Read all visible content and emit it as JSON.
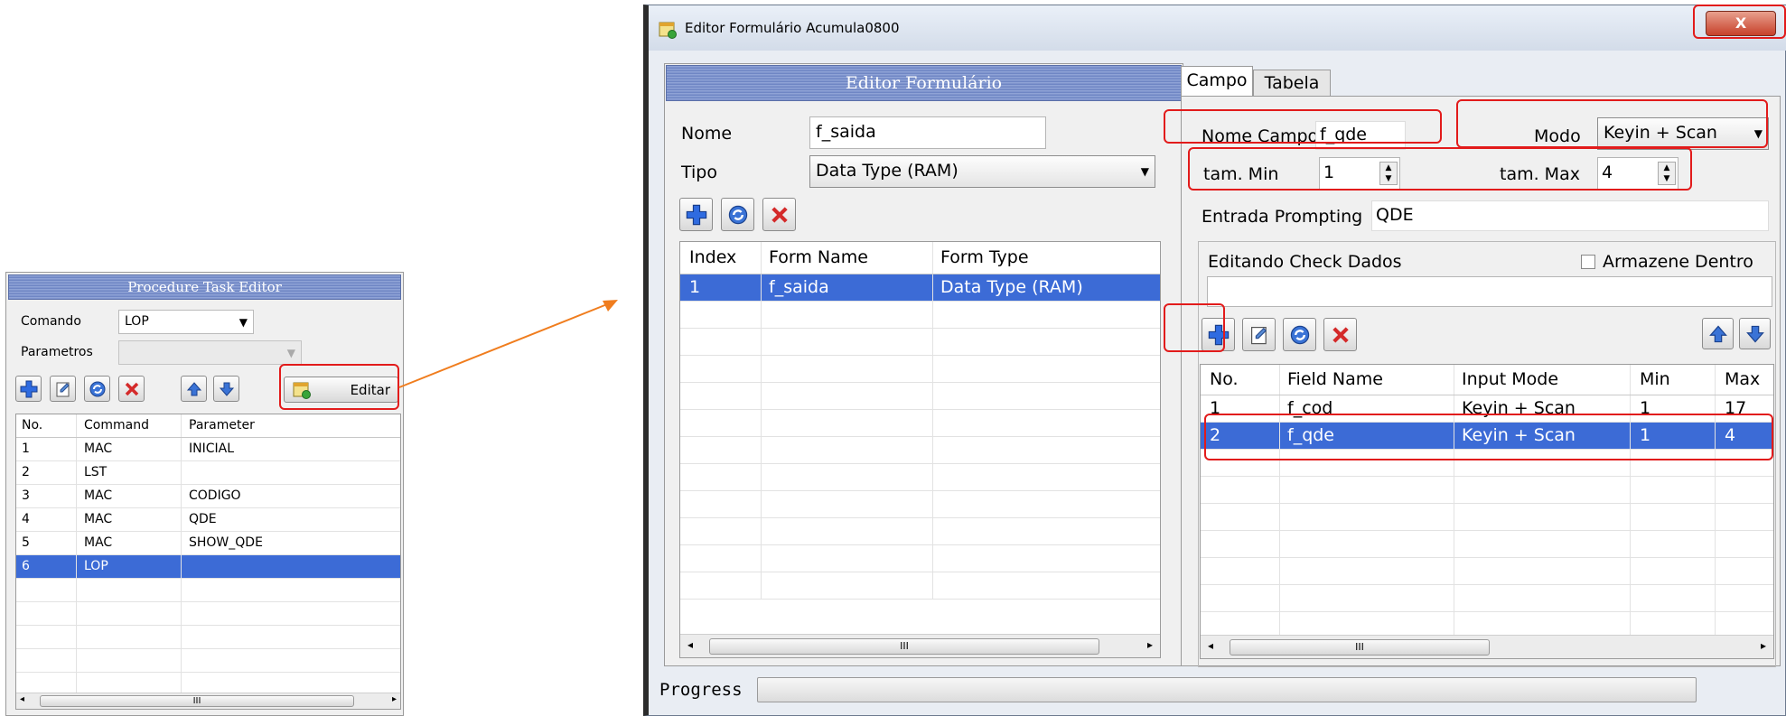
{
  "procedure_editor": {
    "title": "Procedure Task Editor",
    "comando_label": "Comando",
    "comando_value": "LOP",
    "parametros_label": "Parametros",
    "parametros_value": "",
    "editar_label": "Editar",
    "columns": [
      "No.",
      "Command",
      "Parameter"
    ],
    "rows": [
      {
        "no": "1",
        "command": "MAC",
        "parameter": "INICIAL"
      },
      {
        "no": "2",
        "command": "LST",
        "parameter": ""
      },
      {
        "no": "3",
        "command": "MAC",
        "parameter": "CODIGO"
      },
      {
        "no": "4",
        "command": "MAC",
        "parameter": "QDE"
      },
      {
        "no": "5",
        "command": "MAC",
        "parameter": "SHOW_QDE"
      },
      {
        "no": "6",
        "command": "LOP",
        "parameter": ""
      }
    ],
    "selected_row": 6
  },
  "form_editor": {
    "window_title": "Editor Formulário  Acumula0800",
    "close_label": "X",
    "left_title": "Editor Formulário",
    "nome_label": "Nome",
    "nome_value": "f_saida",
    "tipo_label": "Tipo",
    "tipo_value": "Data Type (RAM)",
    "columns": [
      "Index",
      "Form Name",
      "Form Type"
    ],
    "rows": [
      {
        "index": "1",
        "form_name": "f_saida",
        "form_type": "Data Type (RAM)"
      }
    ],
    "tabs": [
      "Campo",
      "Tabela"
    ],
    "active_tab": "Campo",
    "nome_campo_label": "Nome Campo",
    "nome_campo_value": "f_qde",
    "modo_label": "Modo",
    "modo_value": "Keyin + Scan",
    "tam_min_label": "tam. Min",
    "tam_min_value": "1",
    "tam_max_label": "tam. Max",
    "tam_max_value": "4",
    "entrada_label": "Entrada Prompting",
    "entrada_value": "QDE",
    "check_label": "Editando Check Dados",
    "armazene_label": "Armazene Dentro",
    "field_columns": [
      "No.",
      "Field Name",
      "Input Mode",
      "Min",
      "Max"
    ],
    "field_rows": [
      {
        "no": "1",
        "name": "f_cod",
        "mode": "Keyin + Scan",
        "min": "1",
        "max": "17"
      },
      {
        "no": "2",
        "name": "f_qde",
        "mode": "Keyin + Scan",
        "min": "1",
        "max": "4"
      }
    ],
    "selected_field_row": 2,
    "progress_label": "Progress",
    "scroll_grip": "III"
  },
  "colors": {
    "selection": "#3c6bd6",
    "highlight": "#e21b1b",
    "arrow": "#f07d1e",
    "header": "#6f86c4"
  },
  "icons": [
    "add-icon",
    "edit-icon",
    "refresh-icon",
    "delete-icon",
    "arrow-up-icon",
    "arrow-down-icon",
    "form-app-icon"
  ]
}
